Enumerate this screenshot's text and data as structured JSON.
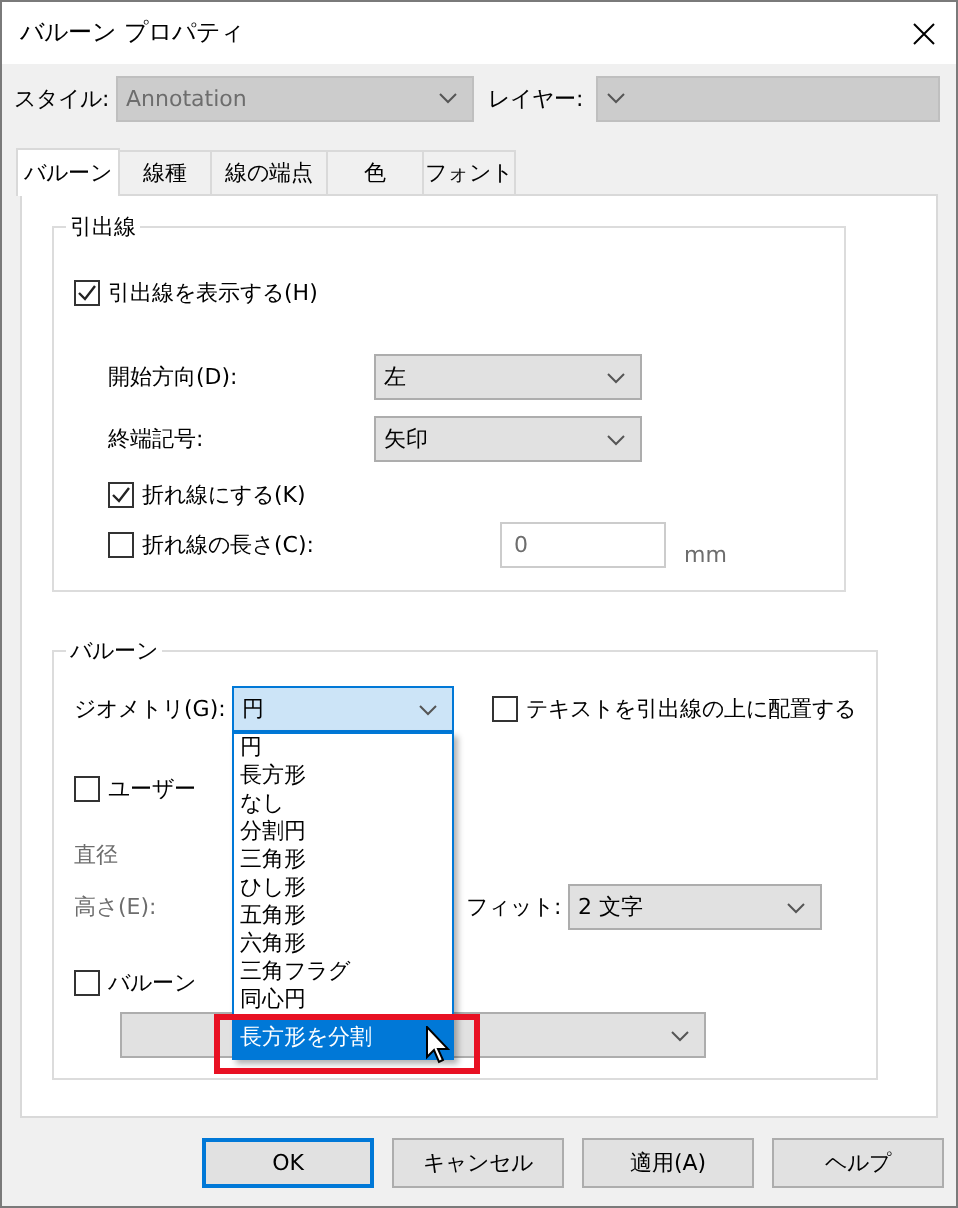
{
  "window": {
    "title": "バルーン プロパティ"
  },
  "top": {
    "style": {
      "label": "スタイル:",
      "value": "Annotation",
      "disabled": true
    },
    "layer": {
      "label": "レイヤー:",
      "disabled": true
    }
  },
  "tabs": [
    {
      "label": "バルーン",
      "selected": true
    },
    {
      "label": "線種",
      "selected": false
    },
    {
      "label": "線の端点",
      "selected": false
    },
    {
      "label": "色",
      "selected": false
    },
    {
      "label": "フォント",
      "selected": false
    }
  ],
  "leader_group": {
    "title": "引出線",
    "show_leader": {
      "label": "引出線を表示する(H)",
      "checked": true
    },
    "fields": [
      {
        "label": "開始方向(D):",
        "value": "左"
      },
      {
        "label": "終端記号:",
        "value": "矢印"
      }
    ],
    "bend": {
      "label": "折れ線にする(K)",
      "checked": true
    },
    "bend_length": {
      "label": "折れ線の長さ(C):",
      "checked": false,
      "value": "0",
      "unit": "mm",
      "disabled": true
    }
  },
  "balloon_group": {
    "title": "バルーン",
    "geometry": {
      "label": "ジオメトリ(G):",
      "value": "円",
      "expanded": true
    },
    "text_above": {
      "label": "テキストを引出線の上に配置する",
      "checked": false
    },
    "custom": {
      "label": "ユーザー",
      "checked": false
    },
    "diameter": {
      "label": "直径",
      "disabled": true
    },
    "height": {
      "label": "高さ(E):",
      "disabled": true
    },
    "fit": {
      "label": "フィット:",
      "value": "2 文字"
    },
    "balloon_check": {
      "label": "バルーン",
      "checked": false
    }
  },
  "dropdown": {
    "highlighted": true,
    "items": [
      {
        "label": "円",
        "selected": false
      },
      {
        "label": "長方形",
        "selected": false
      },
      {
        "label": "なし",
        "selected": false
      },
      {
        "label": "分割円",
        "selected": false
      },
      {
        "label": "三角形",
        "selected": false
      },
      {
        "label": "ひし形",
        "selected": false
      },
      {
        "label": "五角形",
        "selected": false
      },
      {
        "label": "六角形",
        "selected": false
      },
      {
        "label": "三角フラグ",
        "selected": false
      },
      {
        "label": "同心円",
        "selected": false
      },
      {
        "label": "長方形を分割",
        "selected": true
      }
    ]
  },
  "buttons": [
    {
      "label": "OK",
      "default": true
    },
    {
      "label": "キャンセル",
      "default": false
    },
    {
      "label": "適用(A)",
      "default": false
    },
    {
      "label": "ヘルプ",
      "default": false
    }
  ]
}
